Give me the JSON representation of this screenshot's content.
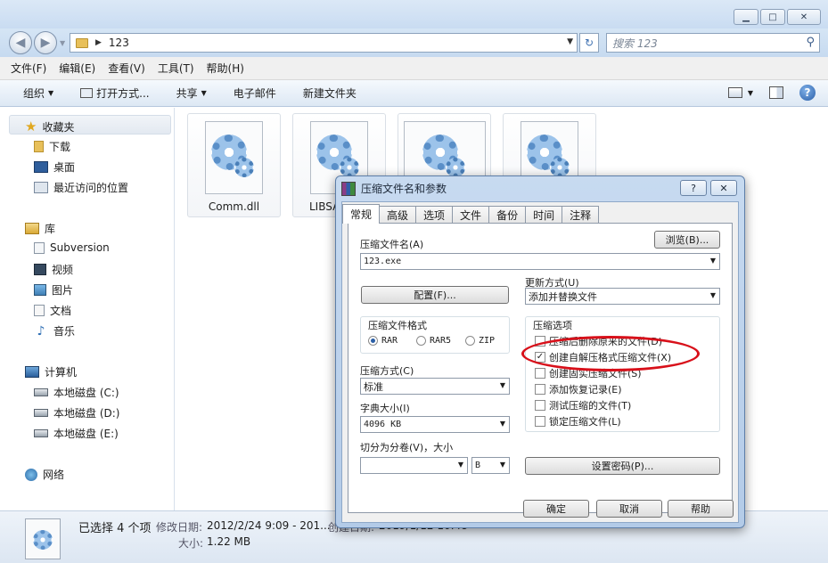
{
  "window": {
    "minimize": "▁",
    "maximize": "□",
    "close": "✕"
  },
  "address": {
    "path": "123",
    "search_placeholder": "搜索 123"
  },
  "menu": [
    "文件(F)",
    "编辑(E)",
    "查看(V)",
    "工具(T)",
    "帮助(H)"
  ],
  "toolbar": {
    "organize": "组织",
    "open_with": "打开方式...",
    "share": "共享",
    "email": "电子邮件",
    "new_folder": "新建文件夹"
  },
  "sidebar": {
    "favorites": "收藏夹",
    "fav_items": [
      "下载",
      "桌面",
      "最近访问的位置"
    ],
    "library": "库",
    "lib_items": [
      "Subversion",
      "视频",
      "图片",
      "文档",
      "音乐"
    ],
    "computer": "计算机",
    "drives": [
      "本地磁盘 (C:)",
      "本地磁盘 (D:)",
      "本地磁盘 (E:)"
    ],
    "network": "网络"
  },
  "files": [
    {
      "name": "Comm.dll"
    },
    {
      "name": "LIBSA"
    },
    {
      "name": ""
    },
    {
      "name": ""
    }
  ],
  "status": {
    "selected": "已选择 4 个项",
    "modified_label": "修改日期:",
    "modified_value": "2012/2/24 9:09 - 201...",
    "created_label": "创建日期:",
    "created_value": "2019/1/12 10:48",
    "size_label": "大小:",
    "size_value": "1.22 MB"
  },
  "dialog": {
    "title": "压缩文件名和参数",
    "help_btn": "?",
    "close_btn": "✕",
    "tabs": [
      "常规",
      "高级",
      "选项",
      "文件",
      "备份",
      "时间",
      "注释"
    ],
    "archive_name_label": "压缩文件名(A)",
    "browse_btn": "浏览(B)...",
    "archive_name_value": "123.exe",
    "update_mode_label": "更新方式(U)",
    "update_mode_value": "添加并替换文件",
    "profiles_btn": "配置(F)...",
    "format_group": "压缩文件格式",
    "formats": [
      "RAR",
      "RAR5",
      "ZIP"
    ],
    "options_group": "压缩选项",
    "options": [
      {
        "label": "压缩后删除原来的文件(D)",
        "checked": false
      },
      {
        "label": "创建自解压格式压缩文件(X)",
        "checked": true
      },
      {
        "label": "创建固实压缩文件(S)",
        "checked": false
      },
      {
        "label": "添加恢复记录(E)",
        "checked": false
      },
      {
        "label": "测试压缩的文件(T)",
        "checked": false
      },
      {
        "label": "锁定压缩文件(L)",
        "checked": false
      }
    ],
    "method_label": "压缩方式(C)",
    "method_value": "标准",
    "dict_label": "字典大小(I)",
    "dict_value": "4096 KB",
    "split_label": "切分为分卷(V)，大小",
    "split_unit": "B",
    "password_btn": "设置密码(P)...",
    "ok": "确定",
    "cancel": "取消",
    "help": "帮助"
  },
  "annotation": {
    "color": "#d8101a"
  }
}
